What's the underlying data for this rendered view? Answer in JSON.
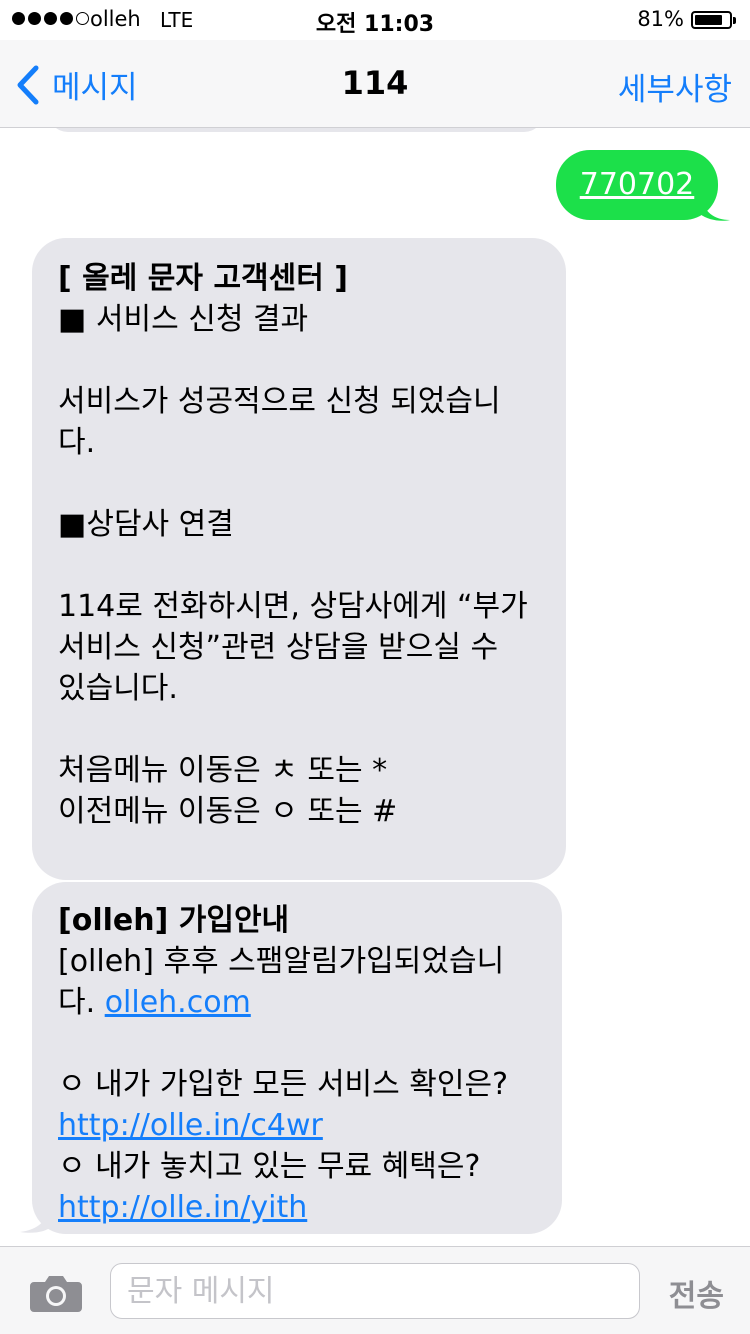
{
  "status_bar": {
    "carrier": "olleh",
    "network": "LTE",
    "time": "오전 11:03",
    "battery_percent_text": "81%",
    "battery_level": 0.81,
    "signal_bars_filled": 4,
    "signal_bars_total": 5
  },
  "nav": {
    "back_label": "메시지",
    "title": "114",
    "details_label": "세부사항",
    "accent_color": "#147efb"
  },
  "messages": {
    "sent": {
      "text": "770702",
      "color": "#1ce04a"
    },
    "received1": {
      "lines": [
        "[ 올레 문자 고객센터 ]",
        "■ 서비스 신청 결과",
        "",
        "서비스가 성공적으로 신청 되었습니",
        "다.",
        "",
        "■상담사 연결",
        "",
        "114로 전화하시면, 상담사에게 “부가",
        "서비스 신청”관련 상담을 받으실 수",
        "있습니다.",
        "",
        "처음메뉴 이동은 ㅊ 또는 *",
        "이전메뉴 이동은 ㅇ 또는 #"
      ]
    },
    "received2": {
      "title": "[olleh] 가입안내",
      "line1": "[olleh] 후후 스팸알림가입되었습니",
      "line2_prefix": "다. ",
      "link1": "olleh.com",
      "question1": "ㅇ 내가 가입한 모든 서비스 확인은?",
      "link2": "http://olle.in/c4wr",
      "question2": "ㅇ 내가 놓치고 있는 무료 혜택은?",
      "link3": "http://olle.in/yith"
    }
  },
  "input_bar": {
    "placeholder": "문자 메시지",
    "send_label": "전송"
  },
  "icons": {
    "back": "chevron-left-icon",
    "camera": "camera-icon",
    "battery": "battery-icon"
  }
}
